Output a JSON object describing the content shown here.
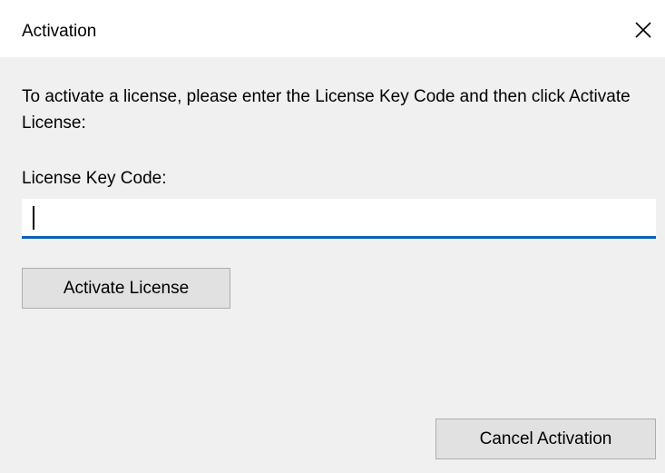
{
  "window": {
    "title": "Activation",
    "close_icon": "close-icon"
  },
  "form": {
    "instructions": "To activate a license, please enter the License Key Code and then click Activate License:",
    "key_label": "License Key Code:",
    "key_value": "",
    "accent_color": "#0a62b8"
  },
  "buttons": {
    "activate_label": "Activate License",
    "cancel_label": "Cancel Activation"
  }
}
